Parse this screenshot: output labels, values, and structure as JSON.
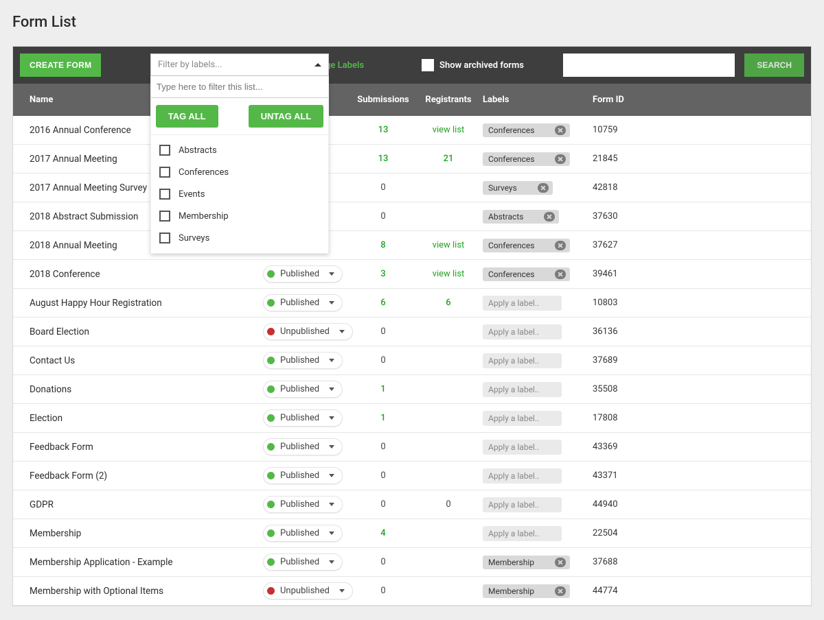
{
  "page_title": "Form List",
  "toolbar": {
    "create_label": "CREATE FORM",
    "filter_placeholder": "Filter by labels...",
    "filter_type_placeholder": "Type here to filter this list...",
    "tag_all": "TAG ALL",
    "untag_all": "UNTAG ALL",
    "filters": [
      "Abstracts",
      "Conferences",
      "Events",
      "Membership",
      "Surveys"
    ],
    "manage_labels": "Manage Labels",
    "show_archived": "Show archived forms",
    "search_btn": "SEARCH"
  },
  "headers": {
    "name": "Name",
    "status": "",
    "submissions": "Submissions",
    "registrants": "Registrants",
    "labels": "Labels",
    "form_id": "Form ID"
  },
  "apply_label_placeholder": "Apply a label..",
  "view_list_text": "view list",
  "rows": [
    {
      "name": "2016 Annual Conference",
      "status": null,
      "subs": "13",
      "subs_green": true,
      "regs": "view list",
      "regs_link": true,
      "label": "Conferences",
      "formid": "10759"
    },
    {
      "name": "2017 Annual Meeting",
      "status": null,
      "subs": "13",
      "subs_green": true,
      "regs": "21",
      "regs_green": true,
      "label": "Conferences",
      "formid": "21845"
    },
    {
      "name": "2017 Annual Meeting Survey",
      "status": null,
      "subs": "0",
      "regs": "",
      "label": "Surveys",
      "formid": "42818"
    },
    {
      "name": "2018 Abstract Submission",
      "status": null,
      "subs": "0",
      "regs": "",
      "label": "Abstracts",
      "formid": "37630"
    },
    {
      "name": "2018 Annual Meeting",
      "status": null,
      "subs": "8",
      "subs_green": true,
      "regs": "view list",
      "regs_link": true,
      "label": "Conferences",
      "formid": "37627"
    },
    {
      "name": "2018 Conference",
      "status": "Published",
      "status_green": true,
      "subs": "3",
      "subs_green": true,
      "regs": "view list",
      "regs_link": true,
      "label": "Conferences",
      "formid": "39461"
    },
    {
      "name": "August Happy Hour Registration",
      "status": "Published",
      "status_green": true,
      "subs": "6",
      "subs_green": true,
      "regs": "6",
      "regs_green": true,
      "label": null,
      "formid": "10803"
    },
    {
      "name": "Board Election",
      "status": "Unpublished",
      "status_green": false,
      "subs": "0",
      "regs": "",
      "label": null,
      "formid": "36136"
    },
    {
      "name": "Contact Us",
      "status": "Published",
      "status_green": true,
      "subs": "0",
      "regs": "",
      "label": null,
      "formid": "37689"
    },
    {
      "name": "Donations",
      "status": "Published",
      "status_green": true,
      "subs": "1",
      "subs_green": true,
      "regs": "",
      "label": null,
      "formid": "35508"
    },
    {
      "name": "Election",
      "status": "Published",
      "status_green": true,
      "subs": "1",
      "subs_green": true,
      "regs": "",
      "label": null,
      "formid": "17808"
    },
    {
      "name": "Feedback Form",
      "status": "Published",
      "status_green": true,
      "subs": "0",
      "regs": "",
      "label": null,
      "formid": "43369"
    },
    {
      "name": "Feedback Form (2)",
      "status": "Published",
      "status_green": true,
      "subs": "0",
      "regs": "",
      "label": null,
      "formid": "43371"
    },
    {
      "name": "GDPR",
      "status": "Published",
      "status_green": true,
      "subs": "0",
      "regs": "0",
      "label": null,
      "formid": "44940"
    },
    {
      "name": "Membership",
      "status": "Published",
      "status_green": true,
      "subs": "4",
      "subs_green": true,
      "regs": "",
      "label": null,
      "formid": "22504"
    },
    {
      "name": "Membership Application - Example",
      "status": "Published",
      "status_green": true,
      "subs": "0",
      "regs": "",
      "label": "Membership",
      "formid": "37688"
    },
    {
      "name": "Membership with Optional Items",
      "status": "Unpublished",
      "status_green": false,
      "subs": "0",
      "regs": "",
      "label": "Membership",
      "formid": "44774"
    }
  ]
}
